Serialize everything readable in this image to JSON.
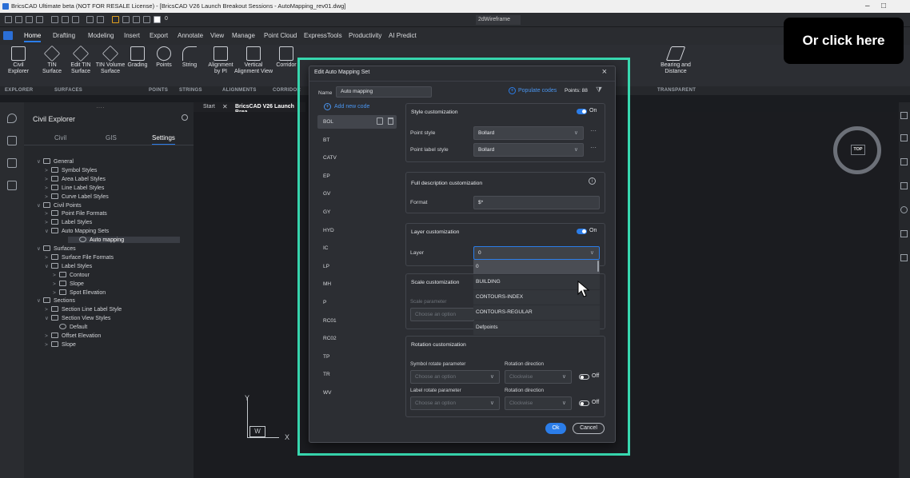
{
  "window": {
    "title": "BricsCAD Ultimate beta (NOT FOR RESALE License) - [BricsCAD V26 Launch Breakout Sessions - AutoMapping_rev01.dwg]",
    "layer_value": "0",
    "workspace": "2dWireframe"
  },
  "menu": [
    "Home",
    "Drafting",
    "Modeling",
    "Insert",
    "Export",
    "Annotate",
    "View",
    "Manage",
    "Point Cloud",
    "ExpressTools",
    "Productivity",
    "AI Predict"
  ],
  "ribbon": {
    "buttons": [
      {
        "label": "Civil\nExplorer"
      },
      {
        "label": "TIN\nSurface"
      },
      {
        "label": "Edit TIN\nSurface"
      },
      {
        "label": "TIN Volume\nSurface"
      },
      {
        "label": "Grading"
      },
      {
        "label": "Points"
      },
      {
        "label": "String"
      },
      {
        "label": "Alignment\nby PI"
      },
      {
        "label": "Vertical\nAlignment View"
      },
      {
        "label": "Corridor"
      },
      {
        "label": "Bearing and\nDistance"
      }
    ],
    "groups": [
      "EXPLORER",
      "SURFACES",
      "POINTS",
      "STRINGS",
      "ALIGNMENTS",
      "CORRIDOR",
      "TRANSPARENT"
    ]
  },
  "explorer": {
    "title": "Civil Explorer",
    "tabs": [
      "Civil",
      "GIS",
      "Settings"
    ],
    "active_tab": "Settings",
    "tree": [
      {
        "label": "General",
        "chev": "∨"
      },
      {
        "label": "Symbol Styles",
        "chev": ">"
      },
      {
        "label": "Area Label Styles",
        "chev": ">"
      },
      {
        "label": "Line Label Styles",
        "chev": ">"
      },
      {
        "label": "Curve Label Styles",
        "chev": ">"
      },
      {
        "label": "Civil Points",
        "chev": "∨"
      },
      {
        "label": "Point File Formats",
        "chev": ">"
      },
      {
        "label": "Label Styles",
        "chev": ">"
      },
      {
        "label": "Auto Mapping Sets",
        "chev": "∨"
      },
      {
        "label": "Auto mapping",
        "chev": ""
      },
      {
        "label": "Surfaces",
        "chev": "∨"
      },
      {
        "label": "Surface File Formats",
        "chev": ">"
      },
      {
        "label": "Label Styles",
        "chev": "∨"
      },
      {
        "label": "Contour",
        "chev": ">"
      },
      {
        "label": "Slope",
        "chev": ">"
      },
      {
        "label": "Spot Elevation",
        "chev": ">"
      },
      {
        "label": "Sections",
        "chev": "∨"
      },
      {
        "label": "Section Line Label Style",
        "chev": ">"
      },
      {
        "label": "Section View Styles",
        "chev": "∨"
      },
      {
        "label": "Default",
        "chev": ""
      },
      {
        "label": "Offset Elevation",
        "chev": ">"
      },
      {
        "label": "Slope",
        "chev": ">"
      }
    ]
  },
  "doc_tabs": {
    "start": "Start",
    "active": "BricsCAD V26 Launch Brea"
  },
  "viewport": {
    "ucs_y": "Y",
    "ucs_x": "X",
    "ucs_w": "W",
    "viewcube": "TOP"
  },
  "overlay": {
    "text": "Or click here"
  },
  "dialog": {
    "title": "Edit Auto Mapping Set",
    "name_label": "Name",
    "name_value": "Auto mapping",
    "populate": "Populate codes",
    "points": "Points: 88",
    "add_code": "Add new code",
    "codes": [
      "BOL",
      "BT",
      "CATV",
      "EP",
      "GV",
      "GY",
      "HYD",
      "IC",
      "LP",
      "MH",
      "P",
      "RC01",
      "RC02",
      "TP",
      "TR",
      "WV"
    ],
    "selected_code": "BOL",
    "style": {
      "header": "Style customization",
      "toggle": "On",
      "point_style_label": "Point style",
      "point_style": "Bollard",
      "point_label_style_label": "Point label style",
      "point_label_style": "Bollard"
    },
    "full_desc": {
      "header": "Full description customization",
      "format_label": "Format",
      "format_value": "$*"
    },
    "layer": {
      "header": "Layer customization",
      "toggle": "On",
      "layer_label": "Layer",
      "layer_value": "0",
      "options": [
        "0",
        "BUILDING",
        "CONTOURS-INDEX",
        "CONTOURS-REGULAR",
        "Defpoints"
      ]
    },
    "scale": {
      "header": "Scale customization",
      "param_label": "Scale parameter",
      "param_placeholder": "Choose an option"
    },
    "rotation": {
      "header": "Rotation customization",
      "sym_param_label": "Symbol rotate parameter",
      "sym_placeholder": "Choose an option",
      "dir_label": "Rotation direction",
      "dir_value": "Clockwise",
      "toggle1": "Off",
      "lbl_param_label": "Label rotate parameter",
      "lbl_placeholder": "Choose an option",
      "dir2_label": "Rotation direction",
      "dir2_value": "Clockwise",
      "toggle2": "Off"
    },
    "ok": "Ok",
    "cancel": "Cancel"
  },
  "colors": {
    "accent": "#2b7de9",
    "highlight": "#38d9b0"
  }
}
